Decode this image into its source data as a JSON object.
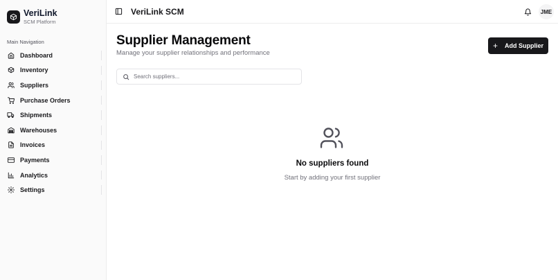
{
  "brand": {
    "title": "VeriLink",
    "subtitle": "SCM Platform"
  },
  "sidebar": {
    "section_label": "Main Navigation",
    "items": [
      {
        "label": "Dashboard",
        "icon": "home-icon"
      },
      {
        "label": "Inventory",
        "icon": "package-icon"
      },
      {
        "label": "Suppliers",
        "icon": "users-icon"
      },
      {
        "label": "Purchase Orders",
        "icon": "cart-icon"
      },
      {
        "label": "Shipments",
        "icon": "truck-icon"
      },
      {
        "label": "Warehouses",
        "icon": "warehouse-icon"
      },
      {
        "label": "Invoices",
        "icon": "file-icon"
      },
      {
        "label": "Payments",
        "icon": "credit-card-icon"
      },
      {
        "label": "Analytics",
        "icon": "bar-chart-icon"
      },
      {
        "label": "Settings",
        "icon": "gear-icon"
      }
    ]
  },
  "header": {
    "title": "VeriLink SCM",
    "avatar_initials": "JME"
  },
  "main": {
    "title": "Supplier Management",
    "subtitle": "Manage your supplier relationships and performance",
    "add_button_label": "Add Supplier",
    "search_placeholder": "Search suppliers...",
    "search_value": "",
    "empty_title": "No suppliers found",
    "empty_subtitle": "Start by adding your first supplier"
  },
  "colors": {
    "primary": "#18181b",
    "muted_text": "#71717a",
    "border": "#e4e4e7",
    "sidebar_bg": "#fafafa"
  }
}
